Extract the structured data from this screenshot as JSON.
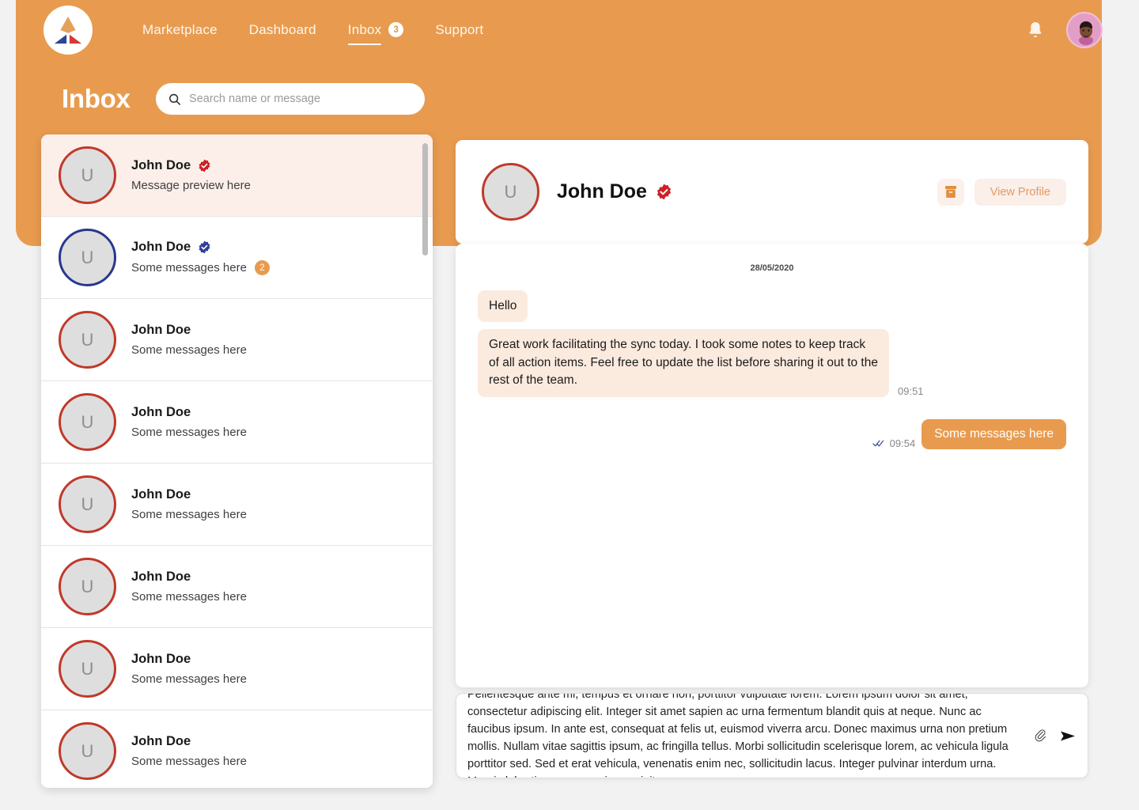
{
  "brand": {
    "logo_icon": "triangle-logo-icon",
    "colors": {
      "orange": "#e89b4f",
      "red": "#c0392b",
      "blue": "#28388c",
      "bubble_in": "#fbeade"
    }
  },
  "nav": {
    "items": [
      {
        "label": "Marketplace",
        "active": false
      },
      {
        "label": "Dashboard",
        "active": false
      },
      {
        "label": "Inbox",
        "active": true,
        "badge": "3"
      },
      {
        "label": "Support",
        "active": false
      }
    ],
    "bell_icon": "notification-bell-icon",
    "avatar_icon": "user-avatar-icon"
  },
  "header": {
    "title": "Inbox"
  },
  "search": {
    "placeholder": "Search name or message",
    "value": "",
    "icon": "search-icon"
  },
  "conversations": [
    {
      "avatar_initial": "U",
      "name": "John Doe",
      "preview": "Message preview here",
      "verified": "red",
      "ring": "red",
      "selected": true,
      "unread": ""
    },
    {
      "avatar_initial": "U",
      "name": "John Doe",
      "preview": "Some messages here",
      "verified": "blue",
      "ring": "blue",
      "selected": false,
      "unread": "2"
    },
    {
      "avatar_initial": "U",
      "name": "John Doe",
      "preview": "Some messages here",
      "verified": "",
      "ring": "red",
      "selected": false,
      "unread": ""
    },
    {
      "avatar_initial": "U",
      "name": "John Doe",
      "preview": "Some messages here",
      "verified": "",
      "ring": "red",
      "selected": false,
      "unread": ""
    },
    {
      "avatar_initial": "U",
      "name": "John Doe",
      "preview": "Some messages here",
      "verified": "",
      "ring": "red",
      "selected": false,
      "unread": ""
    },
    {
      "avatar_initial": "U",
      "name": "John Doe",
      "preview": "Some messages here",
      "verified": "",
      "ring": "red",
      "selected": false,
      "unread": ""
    },
    {
      "avatar_initial": "U",
      "name": "John Doe",
      "preview": "Some messages here",
      "verified": "",
      "ring": "red",
      "selected": false,
      "unread": ""
    },
    {
      "avatar_initial": "U",
      "name": "John Doe",
      "preview": "Some messages here",
      "verified": "",
      "ring": "red",
      "selected": false,
      "unread": ""
    }
  ],
  "chat": {
    "avatar_initial": "U",
    "name": "John Doe",
    "verified": "red",
    "archive_icon": "archive-box-icon",
    "view_profile_label": "View Profile",
    "date": "28/05/2020",
    "messages": [
      {
        "direction": "in",
        "text": "Hello",
        "time": ""
      },
      {
        "direction": "in",
        "text": "Great work facilitating the sync today. I took some notes to keep track of all action items. Feel free to update the list before sharing it out to the rest of the team.",
        "time": "09:51"
      },
      {
        "direction": "out",
        "text": "Some messages here",
        "time": "09:54",
        "status": "read-double-check"
      }
    ]
  },
  "composer": {
    "value": "Pellentesque ante mi, tempus et ornare non, porttitor vulputate lorem. Lorem ipsum dolor sit amet, consectetur adipiscing elit. Integer sit amet sapien ac urna fermentum blandit quis at neque. Nunc ac faucibus ipsum. In ante est, consequat at felis ut, euismod viverra arcu. Donec maximus urna non pretium mollis. Nullam vitae sagittis ipsum, ac fringilla tellus. Morbi sollicitudin scelerisque lorem, ac vehicula ligula porttitor sed. Sed et erat vehicula, venenatis enim nec, sollicitudin lacus. Integer pulvinar interdum urna. Mauris lobortis nec massa in suscipit.",
    "attach_icon": "paperclip-icon",
    "send_icon": "send-arrow-icon"
  }
}
